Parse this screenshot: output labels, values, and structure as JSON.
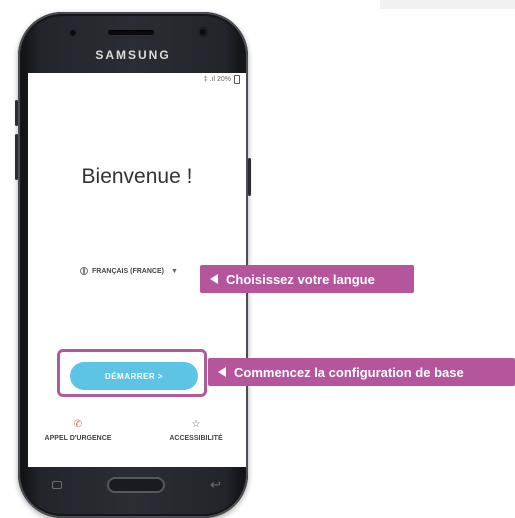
{
  "phone": {
    "brand": "SAMSUNG",
    "status_text": "‡ .ıl 20%"
  },
  "screen": {
    "welcome": "Bienvenue !",
    "language": "FRANÇAIS (FRANCE)",
    "language_arrow": "▼",
    "start_button": "DÉMARRER  >",
    "emergency_call": "APPEL D'URGENCE",
    "accessibility": "ACCESSIBILITÉ"
  },
  "callouts": {
    "language_hint": "Choisissez votre langue",
    "start_hint": "Commencez la configuration de base"
  },
  "icons": {
    "phone": "phone-icon",
    "accessibility": "accessibility-icon",
    "globe": "globe-icon"
  },
  "colors": {
    "accent_button": "#5ec4e6",
    "callout": "#b5559b",
    "emergency_icon": "#e06666"
  }
}
